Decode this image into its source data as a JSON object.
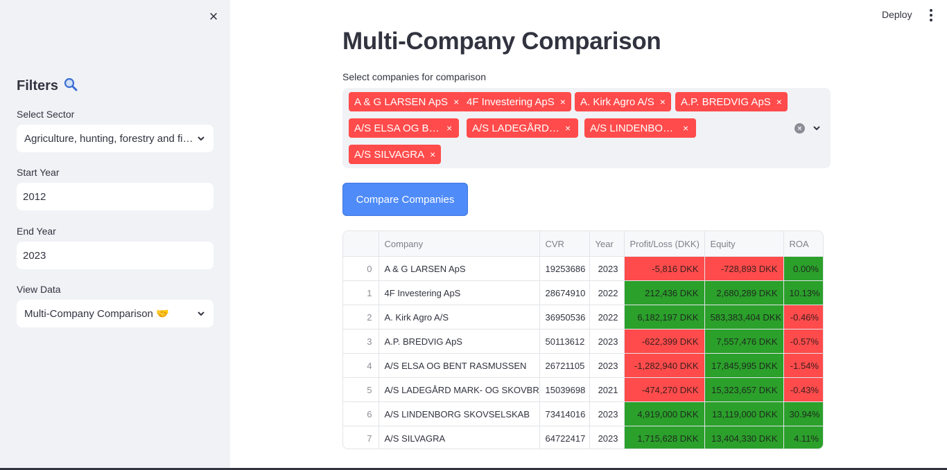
{
  "sidebar": {
    "close_label": "×",
    "title": "Filters",
    "title_icon": "magnifier-icon",
    "sector": {
      "label": "Select Sector",
      "value": "Agriculture, hunting, forestry and fishing"
    },
    "start_year": {
      "label": "Start Year",
      "value": "2012"
    },
    "end_year": {
      "label": "End Year",
      "value": "2023"
    },
    "view_data": {
      "label": "View Data",
      "value": "Multi-Company Comparison 🤝"
    }
  },
  "header": {
    "deploy_label": "Deploy"
  },
  "main": {
    "title": "Multi-Company Comparison",
    "multiselect_label": "Select companies for comparison",
    "selected_tags": [
      "A & G LARSEN ApS",
      "4F Investering ApS",
      "A. Kirk Agro A/S",
      "A.P. BREDVIG ApS",
      "A/S ELSA OG BENT RASMUSSEN",
      "A/S LADEGÅRD MARK- OG SKOVBRUG",
      "A/S LINDENBORG SKOVSELSKAB",
      "A/S SILVAGRA"
    ],
    "tag_remove": "×",
    "clear_label": "×",
    "compare_button": "Compare Companies"
  },
  "table": {
    "columns": [
      "",
      "Company",
      "CVR",
      "Year",
      "Profit/Loss (DKK)",
      "Equity",
      "ROA"
    ],
    "rows": [
      {
        "index": "0",
        "company": "A & G LARSEN ApS",
        "cvr": "19253686",
        "year": "2023",
        "profit": "-5,816 DKK",
        "equity": "-728,893 DKK",
        "roa": "0.00%",
        "profit_status": "neg",
        "equity_status": "neg",
        "roa_status": "pos"
      },
      {
        "index": "1",
        "company": "4F Investering ApS",
        "cvr": "28674910",
        "year": "2022",
        "profit": "212,436 DKK",
        "equity": "2,680,289 DKK",
        "roa": "10.13%",
        "profit_status": "pos",
        "equity_status": "pos",
        "roa_status": "pos"
      },
      {
        "index": "2",
        "company": "A. Kirk Agro A/S",
        "cvr": "36950536",
        "year": "2022",
        "profit": "6,182,197 DKK",
        "equity": "583,383,404 DKK",
        "roa": "-0.46%",
        "profit_status": "pos",
        "equity_status": "pos",
        "roa_status": "neg"
      },
      {
        "index": "3",
        "company": "A.P. BREDVIG ApS",
        "cvr": "50113612",
        "year": "2023",
        "profit": "-622,399 DKK",
        "equity": "7,557,476 DKK",
        "roa": "-0.57%",
        "profit_status": "neg",
        "equity_status": "pos",
        "roa_status": "neg"
      },
      {
        "index": "4",
        "company": "A/S ELSA OG BENT RASMUSSEN",
        "cvr": "26721105",
        "year": "2023",
        "profit": "-1,282,940 DKK",
        "equity": "17,845,995 DKK",
        "roa": "-1.54%",
        "profit_status": "neg",
        "equity_status": "pos",
        "roa_status": "neg"
      },
      {
        "index": "5",
        "company": "A/S LADEGÅRD MARK- OG SKOVBRUG",
        "cvr": "15039698",
        "year": "2021",
        "profit": "-474,270 DKK",
        "equity": "15,323,657 DKK",
        "roa": "-0.43%",
        "profit_status": "neg",
        "equity_status": "pos",
        "roa_status": "neg"
      },
      {
        "index": "6",
        "company": "A/S LINDENBORG SKOVSELSKAB",
        "cvr": "73414016",
        "year": "2023",
        "profit": "4,919,000 DKK",
        "equity": "13,119,000 DKK",
        "roa": "30.94%",
        "profit_status": "pos",
        "equity_status": "pos",
        "roa_status": "pos"
      },
      {
        "index": "7",
        "company": "A/S SILVAGRA",
        "cvr": "64722417",
        "year": "2023",
        "profit": "1,715,628 DKK",
        "equity": "13,404,330 DKK",
        "roa": "4.11%",
        "profit_status": "pos",
        "equity_status": "pos",
        "roa_status": "pos"
      }
    ]
  },
  "colors": {
    "accent_red": "#ff4b4b",
    "accent_green": "#2ba02b",
    "button_blue": "#4f8bf9",
    "sidebar_bg": "#f0f2f6"
  }
}
